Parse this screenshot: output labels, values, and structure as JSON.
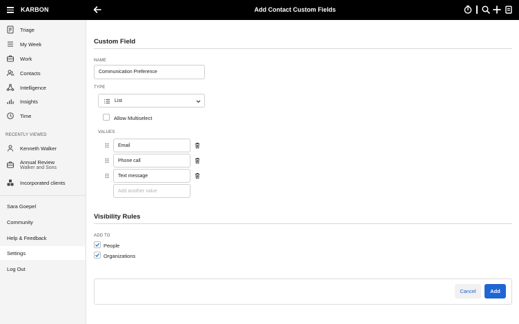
{
  "app": {
    "brand": "KARBON",
    "page_title": "Add Contact Custom Fields"
  },
  "topbar": {
    "icons": [
      "menu-icon",
      "back-arrow-icon",
      "timer-icon",
      "search-icon",
      "plus-icon",
      "notes-icon"
    ]
  },
  "sidebar": {
    "nav": [
      {
        "label": "Triage",
        "icon": "triage-icon"
      },
      {
        "label": "My Week",
        "icon": "list-icon"
      },
      {
        "label": "Work",
        "icon": "briefcase-icon"
      },
      {
        "label": "Contacts",
        "icon": "contacts-icon"
      },
      {
        "label": "Intelligence",
        "icon": "network-icon"
      },
      {
        "label": "Insights",
        "icon": "bar-chart-icon"
      },
      {
        "label": "Time",
        "icon": "clock-icon"
      }
    ],
    "recently_viewed_label": "RECENTLY VIEWED",
    "recent": [
      {
        "label": "Kenneth Walker",
        "sub": "",
        "icon": "person-icon"
      },
      {
        "label": "Annual Review",
        "sub": "Walker and Sons",
        "icon": "briefcase-icon"
      },
      {
        "label": "Incorporated clients",
        "sub": "",
        "icon": "group-icon"
      }
    ],
    "bottom": [
      {
        "label": "Sara Goepel"
      },
      {
        "label": "Community"
      },
      {
        "label": "Help & Feedback"
      },
      {
        "label": "Settings",
        "active": true
      },
      {
        "label": "Log Out"
      }
    ]
  },
  "form": {
    "section_title": "Custom Field",
    "name_label": "NAME",
    "name_value": "Communication Preference",
    "type_label": "TYPE",
    "type_value": "List",
    "allow_multiselect_label": "Allow Multiselect",
    "allow_multiselect_checked": false,
    "values_label": "VALUES",
    "values": [
      "Email",
      "Phone call",
      "Text message"
    ],
    "add_value_placeholder": "Add another value"
  },
  "visibility": {
    "section_title": "Visibility Rules",
    "add_to_label": "ADD TO",
    "options": [
      {
        "label": "People",
        "checked": true
      },
      {
        "label": "Organizations",
        "checked": true
      }
    ]
  },
  "actions": {
    "cancel_label": "Cancel",
    "add_label": "Add"
  },
  "colors": {
    "primary": "#1f65d3",
    "topbar": "#000000",
    "sidebar_bg": "#f4f4f4"
  }
}
